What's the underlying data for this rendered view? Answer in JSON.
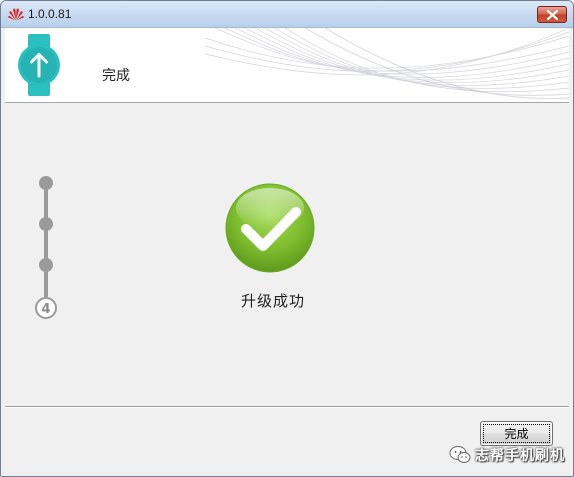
{
  "window": {
    "title": "1.0.0.81"
  },
  "header": {
    "title": "完成"
  },
  "steps": {
    "current_step": "4",
    "total_steps": 4
  },
  "main": {
    "status_text": "升级成功"
  },
  "footer": {
    "finish_label": "完成",
    "watermark_text": "志帮手机刷机"
  },
  "colors": {
    "accent_teal": "#2bbfbf",
    "success_green": "#79b92c",
    "step_gray": "#9a9a9a"
  }
}
